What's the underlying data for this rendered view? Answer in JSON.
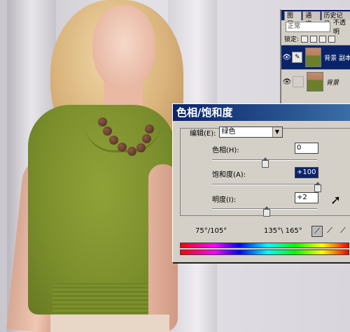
{
  "layers_panel": {
    "tabs": [
      "图层",
      "通道",
      "历史记录"
    ],
    "blend_mode": "正常",
    "opacity_label": "不透明",
    "lock_label": "锁定:",
    "layers": [
      {
        "name": "背景 副本",
        "active": true
      },
      {
        "name": "背景",
        "active": false
      }
    ]
  },
  "dialog": {
    "title": "色相/饱和度",
    "edit_label": "编辑(E):",
    "edit_value": "绿色",
    "hue_label": "色相(H):",
    "hue_value": "0",
    "saturation_label": "饱和度(A):",
    "saturation_value": "+100",
    "lightness_label": "明度(I):",
    "lightness_value": "+2",
    "range_left": "75°/105°",
    "range_right": "135°\\ 165°"
  },
  "sliders": {
    "hue": 0.5,
    "saturation": 1.0,
    "lightness": 0.51
  },
  "colors": {
    "titlebar_start": "#0a246a",
    "titlebar_end": "#3a6ea5",
    "panel_bg": "#d4d0c8"
  },
  "icons": [
    "eye-icon",
    "brush-icon",
    "eyedropper-icon",
    "eyedropper-plus-icon",
    "eyedropper-minus-icon",
    "mouse-cursor-icon"
  ]
}
